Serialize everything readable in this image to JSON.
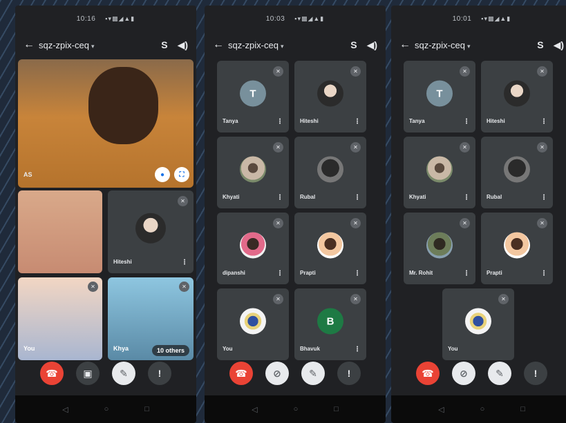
{
  "colors": {
    "end_call": "#ea4335",
    "tile": "#3c4043",
    "screen_bg": "#202124"
  },
  "screens": [
    {
      "status_time": "10:16",
      "meeting_code": "sqz-zpix-ceq",
      "icons": [
        "back-arrow-icon",
        "switch-camera-icon",
        "speaker-icon"
      ],
      "main_tile": {
        "name": "AS"
      },
      "tiles": [
        {
          "name": "Hiteshi"
        },
        {
          "name": "You"
        },
        {
          "name": "Khya",
          "overflow": "10 others"
        }
      ],
      "controls": [
        "end-call",
        "camera",
        "mic-off",
        "more"
      ]
    },
    {
      "status_time": "10:03",
      "meeting_code": "sqz-zpix-ceq",
      "tiles": [
        {
          "name": "Tanya",
          "avatar": "T"
        },
        {
          "name": "Hiteshi"
        },
        {
          "name": "Khyati"
        },
        {
          "name": "Rubal"
        },
        {
          "name": "dipanshi"
        },
        {
          "name": "Prapti"
        },
        {
          "name": "You"
        },
        {
          "name": "Bhavuk",
          "avatar": "B"
        }
      ],
      "controls": [
        "end-call",
        "camera-off",
        "mic-off",
        "more"
      ]
    },
    {
      "status_time": "10:01",
      "meeting_code": "sqz-zpix-ceq",
      "tiles": [
        {
          "name": "Tanya",
          "avatar": "T"
        },
        {
          "name": "Hiteshi"
        },
        {
          "name": "Khyati"
        },
        {
          "name": "Rubal"
        },
        {
          "name": "Mr. Rohit"
        },
        {
          "name": "Prapti"
        },
        {
          "name": "You"
        }
      ],
      "controls": [
        "end-call",
        "camera-off",
        "mic-off",
        "more"
      ]
    }
  ],
  "glyphs": {
    "back": "←",
    "chevron": "▾",
    "switch_camera": "S",
    "speaker": "◀)",
    "more": "⋮",
    "mute": "✕",
    "phone": "☎",
    "camera": "▣",
    "camera_off": "⊘",
    "mic_off": "✎",
    "dots": "!",
    "nav_back": "◁",
    "nav_home": "○",
    "nav_recent": "□",
    "mic": "●",
    "fullscreen": "⛶"
  }
}
